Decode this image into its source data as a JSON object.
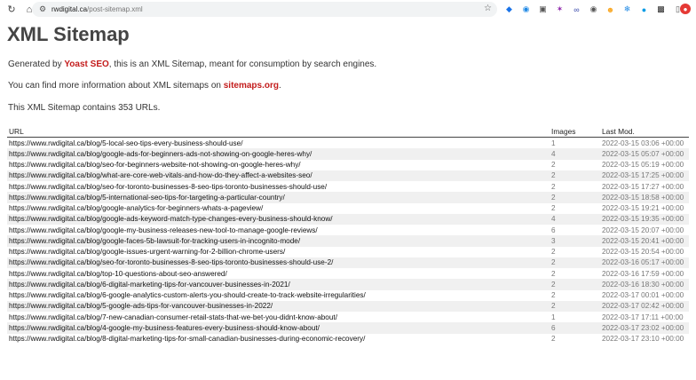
{
  "browser": {
    "url_host": "rwdigital.ca",
    "url_path": "/post-sitemap.xml"
  },
  "page": {
    "title": "XML Sitemap",
    "intro_prefix": "Generated by ",
    "intro_link": "Yoast SEO",
    "intro_suffix": ", this is an XML Sitemap, meant for consumption by search engines.",
    "more_prefix": "You can find more information about XML sitemaps on ",
    "more_link": "sitemaps.org",
    "more_suffix": ".",
    "count_text": "This XML Sitemap contains 353 URLs."
  },
  "table": {
    "headers": {
      "url": "URL",
      "images": "Images",
      "lastmod": "Last Mod."
    },
    "rows": [
      {
        "url": "https://www.rwdigital.ca/blog/5-local-seo-tips-every-business-should-use/",
        "images": "1",
        "lastmod": "2022-03-15 03:06 +00:00"
      },
      {
        "url": "https://www.rwdigital.ca/blog/google-ads-for-beginners-ads-not-showing-on-google-heres-why/",
        "images": "4",
        "lastmod": "2022-03-15 05:07 +00:00"
      },
      {
        "url": "https://www.rwdigital.ca/blog/seo-for-beginners-website-not-showing-on-google-heres-why/",
        "images": "2",
        "lastmod": "2022-03-15 05:19 +00:00"
      },
      {
        "url": "https://www.rwdigital.ca/blog/what-are-core-web-vitals-and-how-do-they-affect-a-websites-seo/",
        "images": "2",
        "lastmod": "2022-03-15 17:25 +00:00"
      },
      {
        "url": "https://www.rwdigital.ca/blog/seo-for-toronto-businesses-8-seo-tips-toronto-businesses-should-use/",
        "images": "2",
        "lastmod": "2022-03-15 17:27 +00:00"
      },
      {
        "url": "https://www.rwdigital.ca/blog/5-international-seo-tips-for-targeting-a-particular-country/",
        "images": "2",
        "lastmod": "2022-03-15 18:58 +00:00"
      },
      {
        "url": "https://www.rwdigital.ca/blog/google-analytics-for-beginners-whats-a-pageview/",
        "images": "2",
        "lastmod": "2022-03-15 19:21 +00:00"
      },
      {
        "url": "https://www.rwdigital.ca/blog/google-ads-keyword-match-type-changes-every-business-should-know/",
        "images": "4",
        "lastmod": "2022-03-15 19:35 +00:00"
      },
      {
        "url": "https://www.rwdigital.ca/blog/google-my-business-releases-new-tool-to-manage-google-reviews/",
        "images": "6",
        "lastmod": "2022-03-15 20:07 +00:00"
      },
      {
        "url": "https://www.rwdigital.ca/blog/google-faces-5b-lawsuit-for-tracking-users-in-incognito-mode/",
        "images": "3",
        "lastmod": "2022-03-15 20:41 +00:00"
      },
      {
        "url": "https://www.rwdigital.ca/blog/google-issues-urgent-warning-for-2-billion-chrome-users/",
        "images": "2",
        "lastmod": "2022-03-15 20:54 +00:00"
      },
      {
        "url": "https://www.rwdigital.ca/blog/seo-for-toronto-businesses-8-seo-tips-toronto-businesses-should-use-2/",
        "images": "2",
        "lastmod": "2022-03-16 05:17 +00:00"
      },
      {
        "url": "https://www.rwdigital.ca/blog/top-10-questions-about-seo-answered/",
        "images": "2",
        "lastmod": "2022-03-16 17:59 +00:00"
      },
      {
        "url": "https://www.rwdigital.ca/blog/6-digital-marketing-tips-for-vancouver-businesses-in-2021/",
        "images": "2",
        "lastmod": "2022-03-16 18:30 +00:00"
      },
      {
        "url": "https://www.rwdigital.ca/blog/6-google-analytics-custom-alerts-you-should-create-to-track-website-irregularities/",
        "images": "2",
        "lastmod": "2022-03-17 00:01 +00:00"
      },
      {
        "url": "https://www.rwdigital.ca/blog/5-google-ads-tips-for-vancouver-businesses-in-2022/",
        "images": "2",
        "lastmod": "2022-03-17 02:42 +00:00"
      },
      {
        "url": "https://www.rwdigital.ca/blog/7-new-canadian-consumer-retail-stats-that-we-bet-you-didnt-know-about/",
        "images": "1",
        "lastmod": "2022-03-17 17:11 +00:00"
      },
      {
        "url": "https://www.rwdigital.ca/blog/4-google-my-business-features-every-business-should-know-about/",
        "images": "6",
        "lastmod": "2022-03-17 23:02 +00:00"
      },
      {
        "url": "https://www.rwdigital.ca/blog/8-digital-marketing-tips-for-small-canadian-businesses-during-economic-recovery/",
        "images": "2",
        "lastmod": "2022-03-17 23:10 +00:00"
      }
    ]
  }
}
